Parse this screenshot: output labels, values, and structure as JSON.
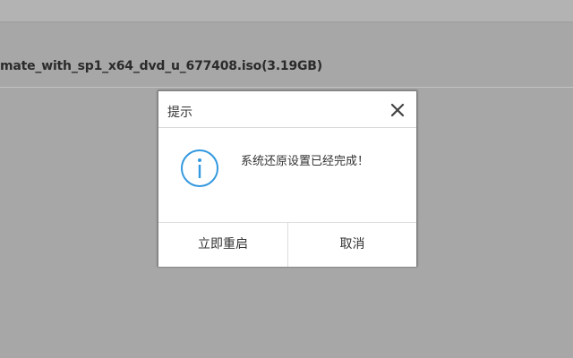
{
  "background": {
    "file_label": "mate_with_sp1_x64_dvd_u_677408.iso(3.19GB)"
  },
  "dialog": {
    "title": "提示",
    "close_icon": "close-icon",
    "info_icon": "info-icon",
    "message": "系统还原设置已经完成！",
    "buttons": {
      "restart": "立即重启",
      "cancel": "取消"
    }
  },
  "colors": {
    "overlay_background": "#a7a7a7",
    "dialog_background": "#ffffff",
    "info_accent": "#3399e0",
    "text": "#333333"
  }
}
